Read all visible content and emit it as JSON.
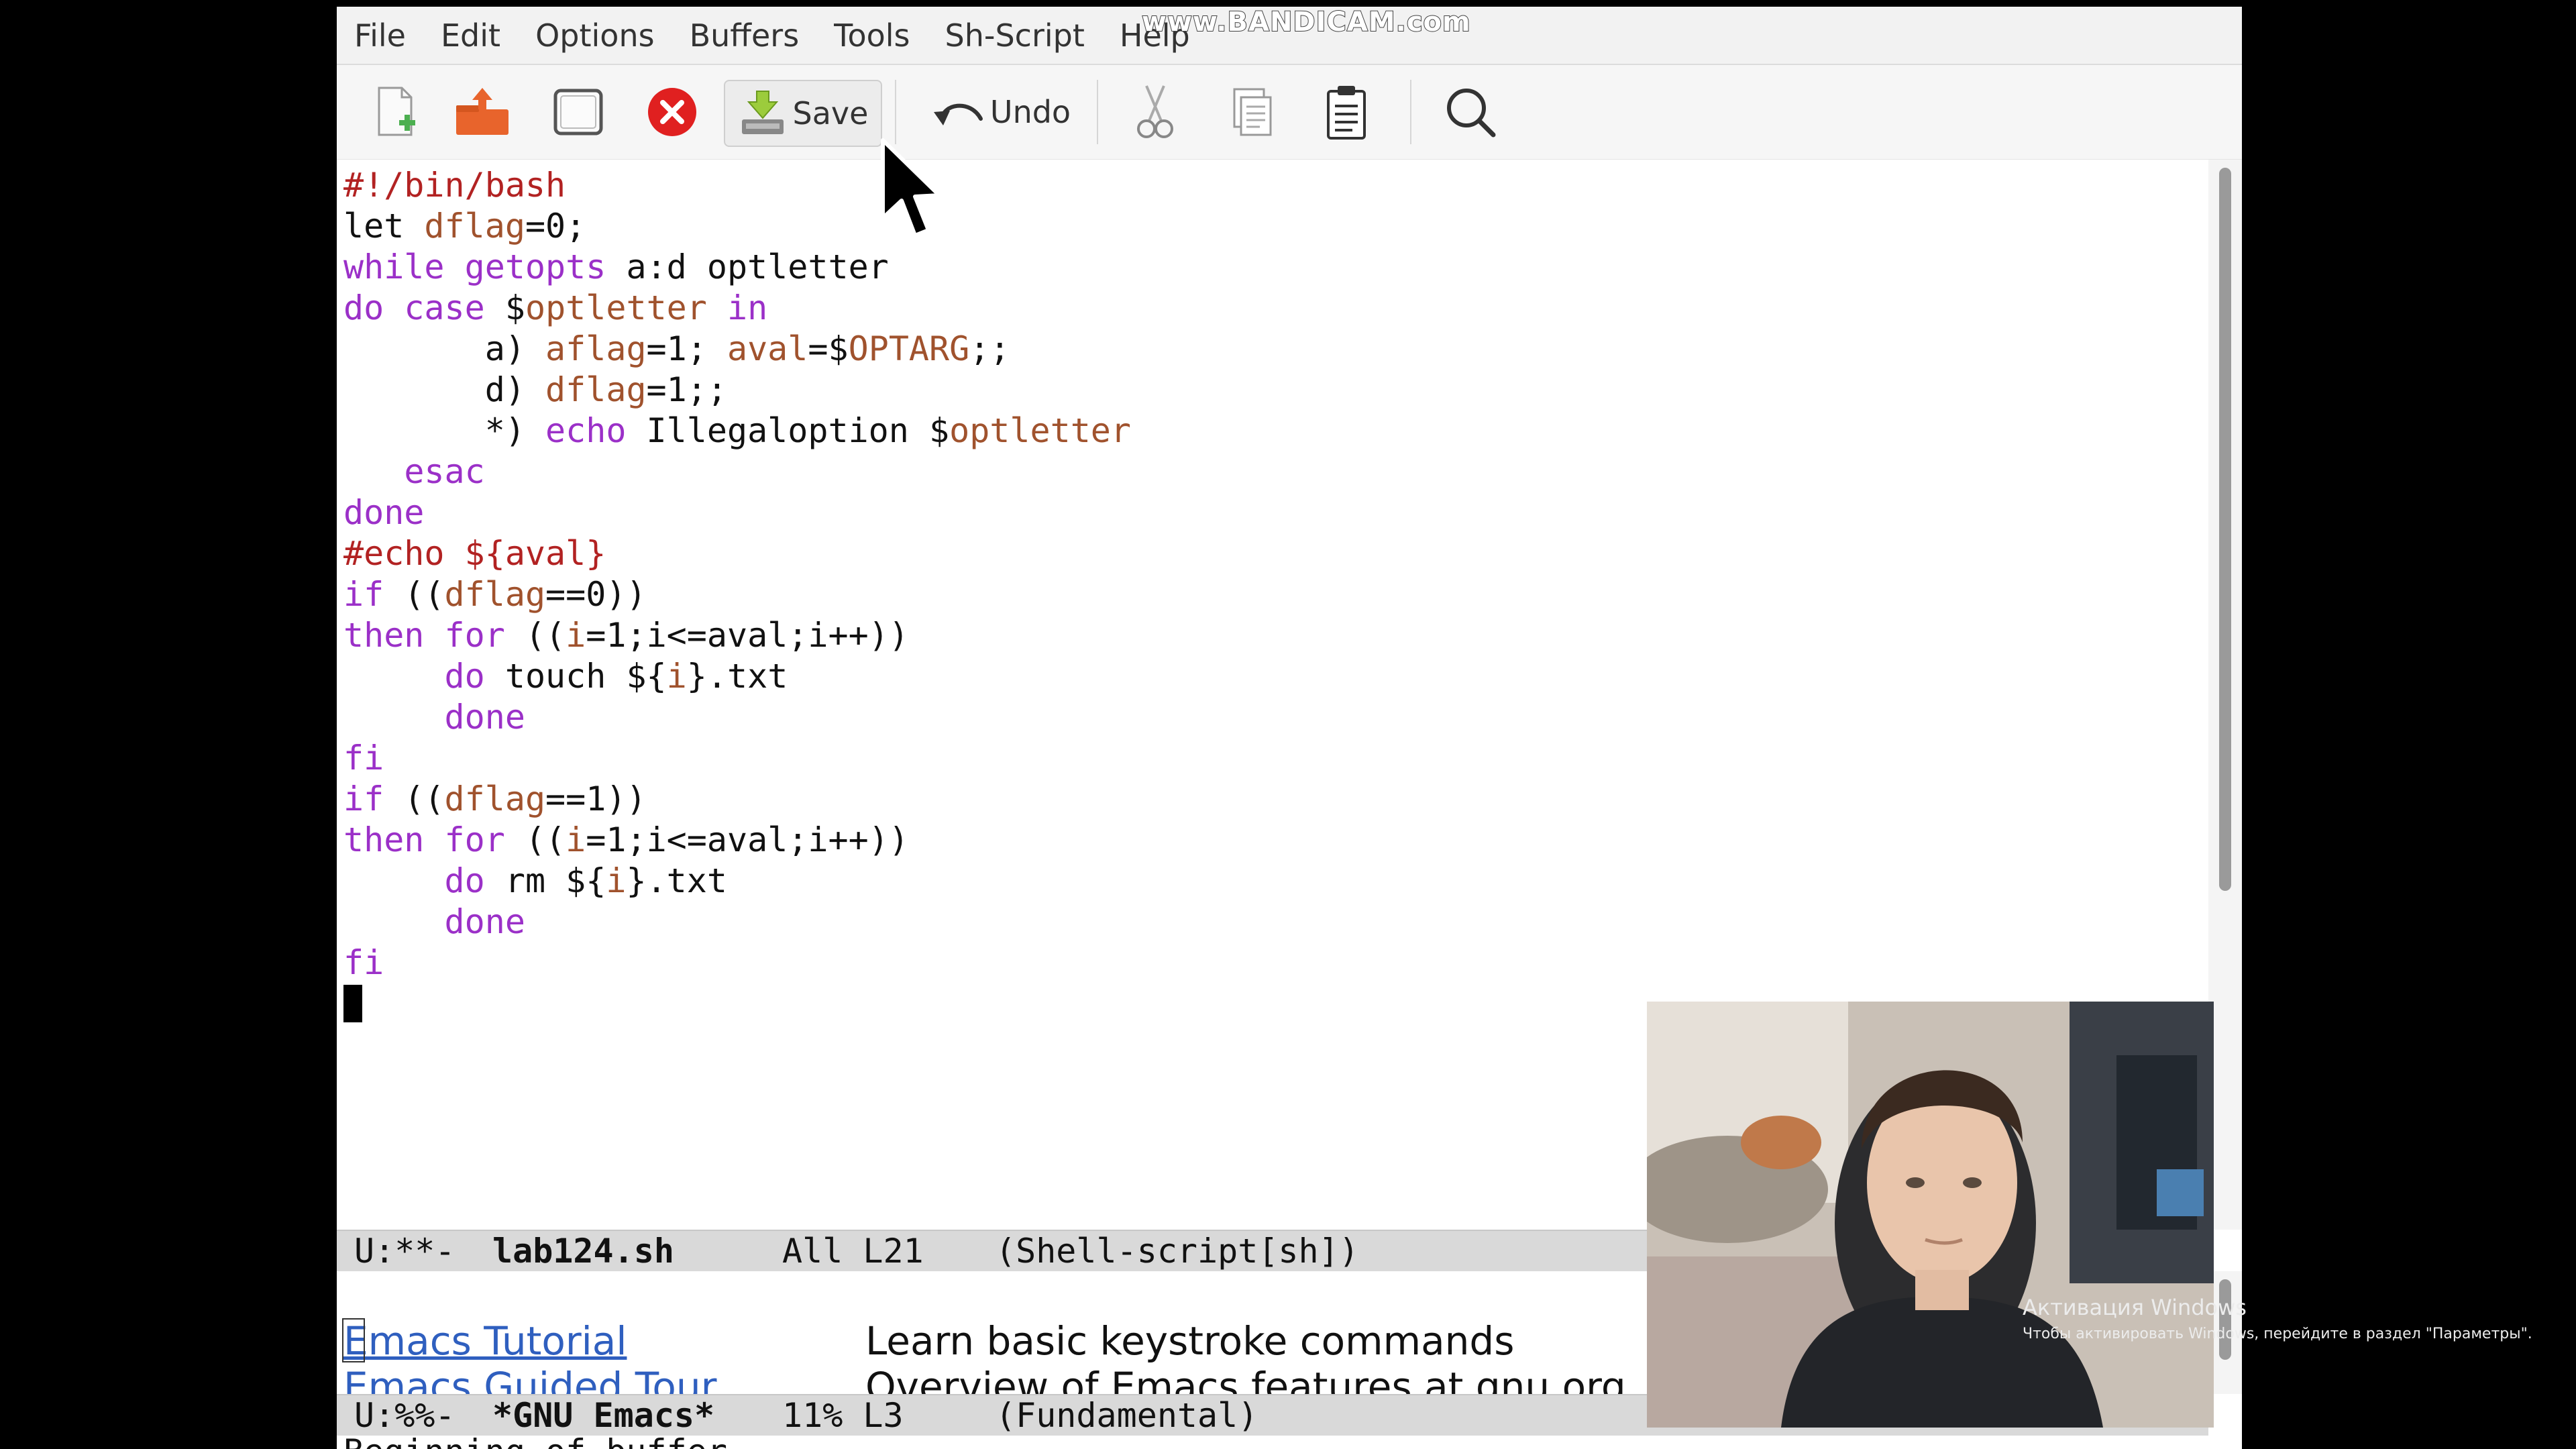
{
  "menubar": {
    "items": [
      "File",
      "Edit",
      "Options",
      "Buffers",
      "Tools",
      "Sh-Script",
      "Help"
    ]
  },
  "watermark": "www.BANDICAM.com",
  "toolbar": {
    "new_file_icon": "new-file-icon",
    "open_folder_icon": "open-folder-icon",
    "dired_icon": "dired-icon",
    "close_icon": "close-icon",
    "save_label": "Save",
    "undo_label": "Undo",
    "cut_icon": "scissors-icon",
    "copy_icon": "copy-icon",
    "paste_icon": "paste-icon",
    "search_icon": "search-icon"
  },
  "editor": {
    "lines": [
      [
        {
          "t": "#!/bin/bash",
          "c": "cm"
        }
      ],
      [
        {
          "t": "let ",
          "c": ""
        },
        {
          "t": "dflag",
          "c": "vr"
        },
        {
          "t": "=0;",
          "c": ""
        }
      ],
      [
        {
          "t": "while",
          "c": "kw"
        },
        {
          "t": " ",
          "c": ""
        },
        {
          "t": "getopts",
          "c": "kw"
        },
        {
          "t": " a:d optletter",
          "c": ""
        }
      ],
      [
        {
          "t": "do",
          "c": "kw"
        },
        {
          "t": " ",
          "c": ""
        },
        {
          "t": "case",
          "c": "kw"
        },
        {
          "t": " $",
          "c": ""
        },
        {
          "t": "optletter",
          "c": "vr"
        },
        {
          "t": " ",
          "c": ""
        },
        {
          "t": "in",
          "c": "kw"
        }
      ],
      [
        {
          "t": "       a) ",
          "c": ""
        },
        {
          "t": "aflag",
          "c": "vr"
        },
        {
          "t": "=1; ",
          "c": ""
        },
        {
          "t": "aval",
          "c": "vr"
        },
        {
          "t": "=$",
          "c": ""
        },
        {
          "t": "OPTARG",
          "c": "vr"
        },
        {
          "t": ";;",
          "c": ""
        }
      ],
      [
        {
          "t": "       d) ",
          "c": ""
        },
        {
          "t": "dflag",
          "c": "vr"
        },
        {
          "t": "=1;;",
          "c": ""
        }
      ],
      [
        {
          "t": "       *) ",
          "c": ""
        },
        {
          "t": "echo",
          "c": "kw"
        },
        {
          "t": " Illegaloption $",
          "c": ""
        },
        {
          "t": "optletter",
          "c": "vr"
        }
      ],
      [
        {
          "t": "   ",
          "c": ""
        },
        {
          "t": "esac",
          "c": "kw"
        }
      ],
      [
        {
          "t": "done",
          "c": "kw"
        }
      ],
      [
        {
          "t": "#echo ${aval}",
          "c": "cm"
        }
      ],
      [
        {
          "t": "if",
          "c": "kw"
        },
        {
          "t": " ((",
          "c": ""
        },
        {
          "t": "dflag",
          "c": "vr"
        },
        {
          "t": "==0))",
          "c": ""
        }
      ],
      [
        {
          "t": "then",
          "c": "kw"
        },
        {
          "t": " ",
          "c": ""
        },
        {
          "t": "for",
          "c": "kw"
        },
        {
          "t": " ((",
          "c": ""
        },
        {
          "t": "i",
          "c": "vr"
        },
        {
          "t": "=1;i<=aval;i++))",
          "c": ""
        }
      ],
      [
        {
          "t": "     ",
          "c": ""
        },
        {
          "t": "do",
          "c": "kw"
        },
        {
          "t": " touch ${",
          "c": ""
        },
        {
          "t": "i",
          "c": "vr"
        },
        {
          "t": "}.txt",
          "c": ""
        }
      ],
      [
        {
          "t": "     ",
          "c": ""
        },
        {
          "t": "done",
          "c": "kw"
        }
      ],
      [
        {
          "t": "fi",
          "c": "kw"
        }
      ],
      [
        {
          "t": "if",
          "c": "kw"
        },
        {
          "t": " ((",
          "c": ""
        },
        {
          "t": "dflag",
          "c": "vr"
        },
        {
          "t": "==1))",
          "c": ""
        }
      ],
      [
        {
          "t": "then",
          "c": "kw"
        },
        {
          "t": " ",
          "c": ""
        },
        {
          "t": "for",
          "c": "kw"
        },
        {
          "t": " ((",
          "c": ""
        },
        {
          "t": "i",
          "c": "vr"
        },
        {
          "t": "=1;i<=aval;i++))",
          "c": ""
        }
      ],
      [
        {
          "t": "     ",
          "c": ""
        },
        {
          "t": "do",
          "c": "kw"
        },
        {
          "t": " rm ${",
          "c": ""
        },
        {
          "t": "i",
          "c": "vr"
        },
        {
          "t": "}.txt",
          "c": ""
        }
      ],
      [
        {
          "t": "     ",
          "c": ""
        },
        {
          "t": "done",
          "c": "kw"
        }
      ],
      [
        {
          "t": "fi",
          "c": "kw"
        }
      ]
    ]
  },
  "modeline_main": {
    "state": "U:**-",
    "buffer": "lab124.sh",
    "position": "All L21",
    "mode": "(Shell-script[sh])"
  },
  "lower_buffer": {
    "items": [
      {
        "link": "Emacs Tutorial",
        "desc": "Learn basic keystroke commands"
      },
      {
        "link": "Emacs Guided Tour",
        "desc": "Overview of Emacs features at gnu.org"
      }
    ]
  },
  "modeline_lower": {
    "state": "U:%%-",
    "buffer": "*GNU Emacs*",
    "position": "11% L3",
    "mode": "(Fundamental)"
  },
  "echo_area": "Beginning of buffer",
  "activation": {
    "title": "Активация Windows",
    "subtitle": "Чтобы активировать Windows, перейдите в раздел \"Параметры\"."
  },
  "colors": {
    "keyword": "#9b30c8",
    "variable": "#a0522d",
    "comment": "#b22222",
    "link": "#2f5fbf",
    "close_button": "#e02020"
  }
}
